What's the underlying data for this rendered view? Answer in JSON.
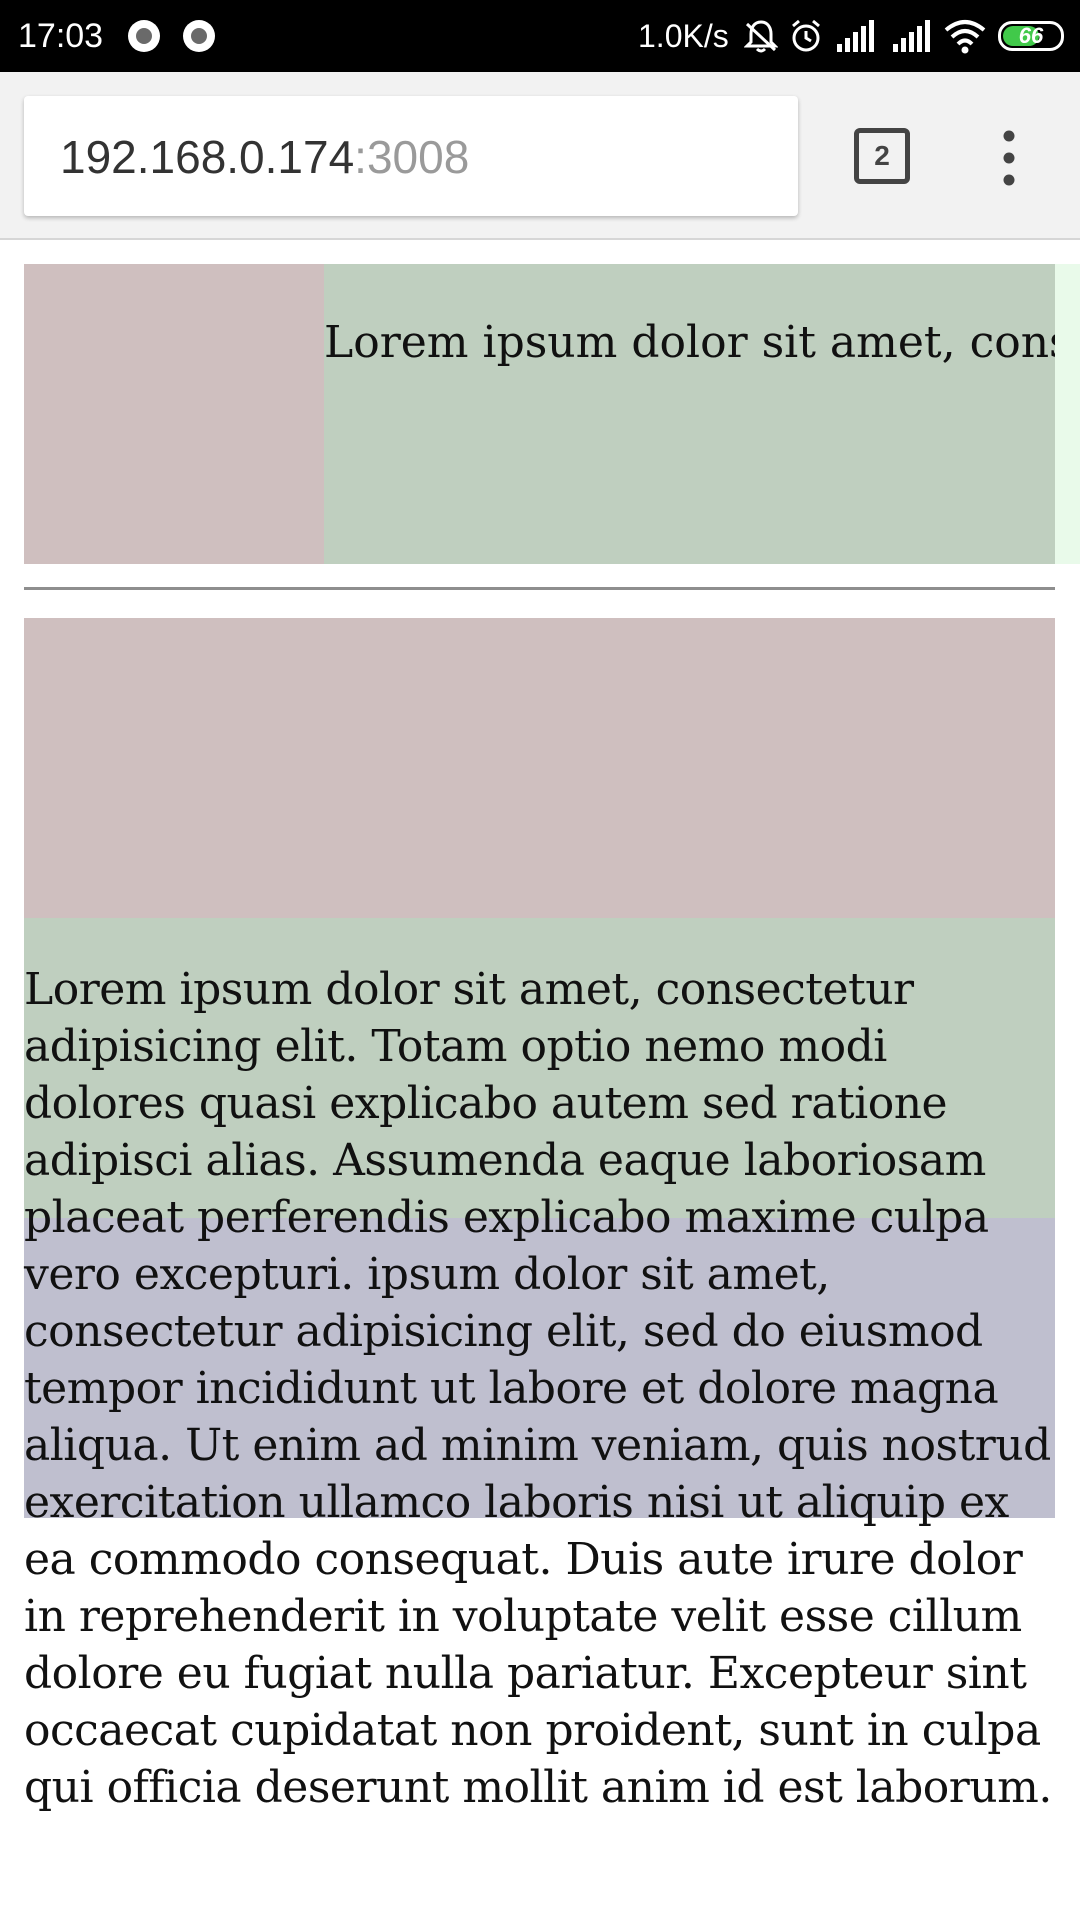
{
  "status_bar": {
    "time": "17:03",
    "net_speed": "1.0K/s",
    "battery_level": "66",
    "icons": [
      "notification-dot-icon",
      "notification-dot-icon",
      "mute-icon",
      "alarm-icon",
      "signal-icon",
      "signal-icon",
      "wifi-icon",
      "battery-icon"
    ]
  },
  "browser": {
    "url_host": "192.168.0.174",
    "url_port": ":3008",
    "tab_count": "2",
    "menu_icon": "more-vert-icon"
  },
  "page": {
    "row1_text": "Lorem ipsum dolor sit amet, consectetur adipisicing elit.",
    "paragraph": "Lorem ipsum dolor sit amet, consectetur adipisicing elit. Totam optio nemo modi dolores quasi explicabo autem sed ratione adipisci alias. Assumenda eaque laboriosam placeat perferendis explicabo maxime culpa vero excepturi. ipsum dolor sit amet, consectetur adipisicing elit, sed do eiusmod tempor incididunt ut labore et dolore magna aliqua. Ut enim ad minim veniam, quis nostrud exercitation ullamco laboris nisi ut aliquip ex ea commodo consequat. Duis aute irure dolor in reprehenderit in voluptate velit esse cillum dolore eu fugiat nulla pariatur. Excepteur sint occaecat cupidatat non proident, sunt in culpa qui officia deserunt mollit anim id est laborum."
  },
  "colors": {
    "pink_block": "#cfbfbf",
    "green_block": "#bfcfbf",
    "blue_block": "#bfbfcf",
    "light_green": "#e9faea",
    "battery": "#41c94a"
  }
}
